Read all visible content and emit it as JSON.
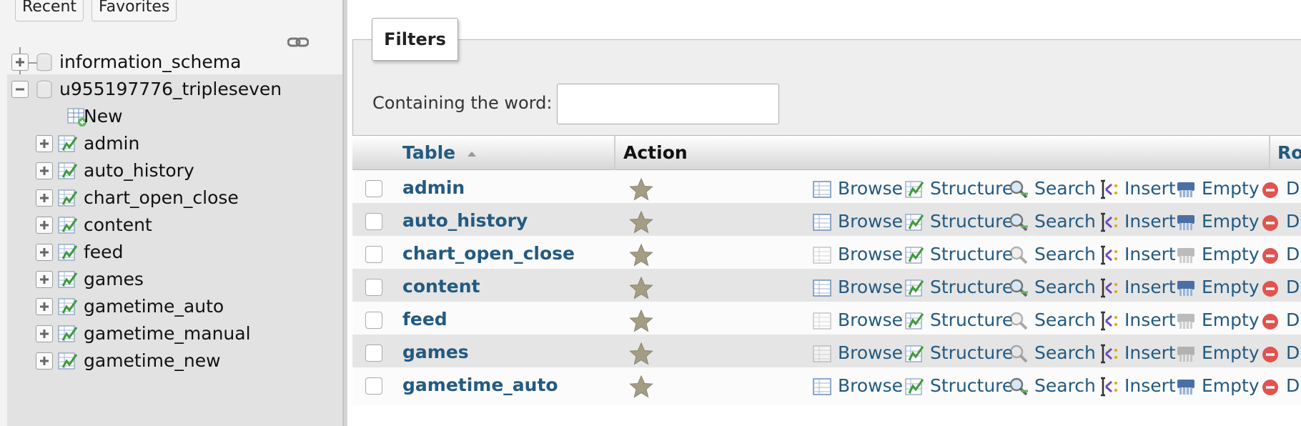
{
  "nav": {
    "tabs": {
      "recent": "Recent",
      "favorites": "Favorites"
    },
    "databases": [
      {
        "name": "information_schema",
        "expanded": false
      },
      {
        "name": "u955197776_tripleseven",
        "expanded": true
      }
    ],
    "new_label": "New",
    "tables": [
      "admin",
      "auto_history",
      "chart_open_close",
      "content",
      "feed",
      "games",
      "gametime_auto",
      "gametime_manual",
      "gametime_new"
    ]
  },
  "filters": {
    "legend": "Filters",
    "label": "Containing the word:",
    "value": ""
  },
  "table": {
    "headers": {
      "table": "Table",
      "action": "Action",
      "rows": "Rows"
    },
    "action_labels": {
      "browse": "Browse",
      "structure": "Structure",
      "search": "Search",
      "insert": "Insert",
      "empty": "Empty",
      "drop": "Drop"
    },
    "rows": [
      {
        "name": "admin",
        "has_data": true
      },
      {
        "name": "auto_history",
        "has_data": true
      },
      {
        "name": "chart_open_close",
        "has_data": false
      },
      {
        "name": "content",
        "has_data": true
      },
      {
        "name": "feed",
        "has_data": false
      },
      {
        "name": "games",
        "has_data": false
      },
      {
        "name": "gametime_auto",
        "has_data": true
      }
    ]
  },
  "colors": {
    "link": "#235a81",
    "drop": "#e0534f",
    "star": "#9b9580",
    "selected_row": "#e2e2e2"
  }
}
